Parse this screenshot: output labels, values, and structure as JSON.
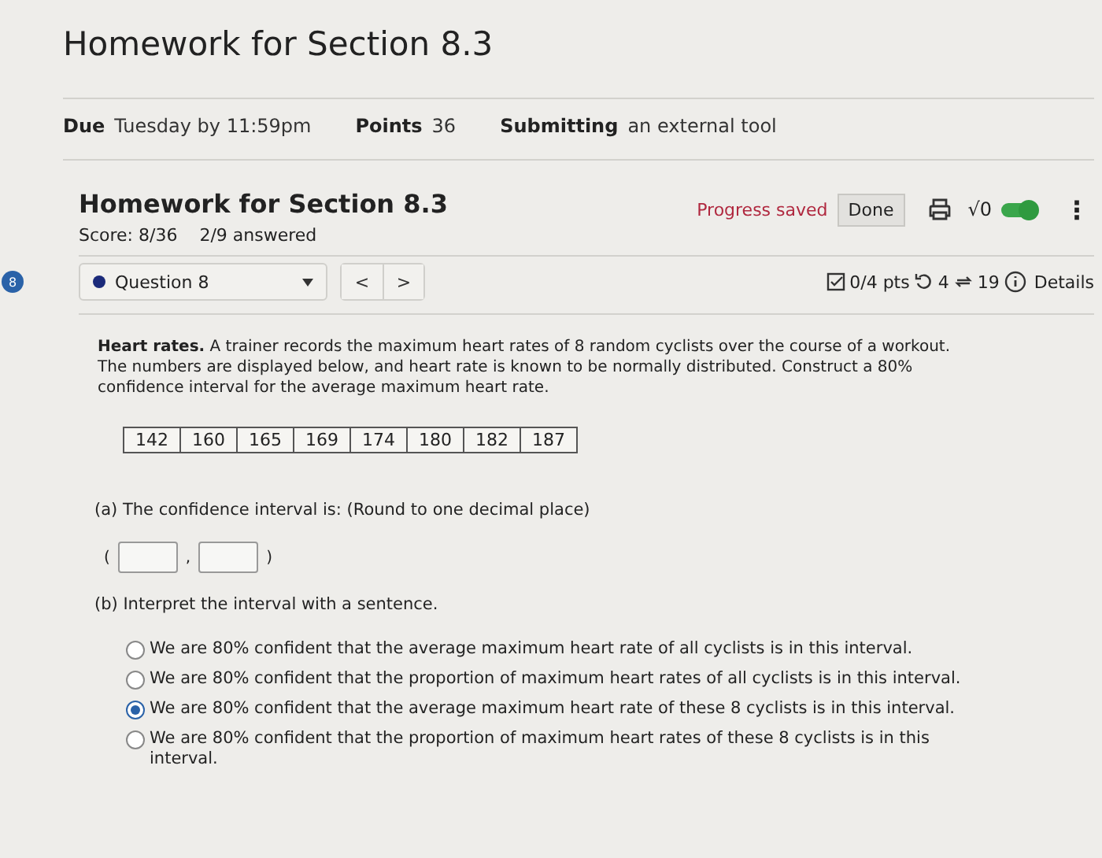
{
  "page_title": "Homework for Section 8.3",
  "meta": [
    {
      "label": "Due",
      "value": "Tuesday by 11:59pm"
    },
    {
      "label": "Points",
      "value": "36"
    },
    {
      "label": "Submitting",
      "value": "an external tool"
    }
  ],
  "quiz": {
    "title": "Homework for Section 8.3",
    "score": "Score: 8/36",
    "answered": "2/9 answered",
    "status": "Progress saved",
    "done_button": "Done",
    "math_symbol": "√0",
    "math_toggle": {
      "on": true
    },
    "more": "⋮"
  },
  "question_bar": {
    "badge": "8",
    "question": "Question 8",
    "prev": "<",
    "next": ">",
    "points": "0/4 pts",
    "retries": "4",
    "attempts": "19",
    "details": "Details"
  },
  "question": {
    "text": "**Heart rates.** A trainer records the maximum heart rates of 8 random cyclists over the course of a workout. The numbers are displayed below, and heart rate is known to be normally distributed. Construct a 80% confidence interval for the average maximum heart rate.",
    "data": [
      "142",
      "160",
      "165",
      "169",
      "174",
      "180",
      "182",
      "187"
    ],
    "part_a": "(a) The confidence interval is: (Round to one decimal place)",
    "open_paren": "(",
    "comma": ",",
    "close_paren": ")",
    "part_b": "(b) Interpret the interval with a sentence.",
    "options": [
      {
        "text": "We are 80% confident that the average maximum heart rate of all cyclists is in this interval.",
        "selected": false
      },
      {
        "text": "We are 80% confident that the proportion of maximum heart rates of all cyclists is in this interval.",
        "selected": false
      },
      {
        "text": "We are 80% confident that the average maximum heart rate of these 8 cyclists is in this interval.",
        "selected": true
      },
      {
        "text": "We are 80% confident that the proportion of maximum heart rates of these 8 cyclists is in this interval.",
        "selected": false
      }
    ]
  }
}
